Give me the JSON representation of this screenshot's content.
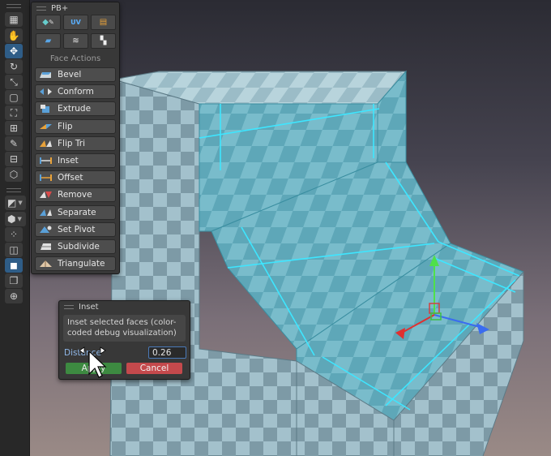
{
  "panel": {
    "title": "PB+",
    "section_label": "Face Actions",
    "mode_buttons": [
      {
        "icon": "new-shape-icon"
      },
      {
        "icon": "uv-editor-icon",
        "text": "UV"
      },
      {
        "icon": "material-editor-icon"
      },
      {
        "icon": "smoothing-groups-icon"
      },
      {
        "icon": "vertex-color-icon"
      },
      {
        "icon": "checker-texture-icon"
      }
    ],
    "actions": [
      {
        "label": "Bevel",
        "icon": "bevel-icon"
      },
      {
        "label": "Conform",
        "icon": "conform-icon"
      },
      {
        "label": "Extrude",
        "icon": "extrude-icon"
      },
      {
        "label": "Flip",
        "icon": "flip-icon"
      },
      {
        "label": "Flip Tri",
        "icon": "flip-tri-icon"
      },
      {
        "label": "Inset",
        "icon": "inset-icon"
      },
      {
        "label": "Offset",
        "icon": "offset-icon"
      },
      {
        "label": "Remove",
        "icon": "remove-icon"
      },
      {
        "label": "Separate",
        "icon": "separate-icon"
      },
      {
        "label": "Set Pivot",
        "icon": "set-pivot-icon"
      },
      {
        "label": "Subdivide",
        "icon": "subdivide-icon"
      },
      {
        "label": "Triangulate",
        "icon": "triangulate-icon"
      }
    ]
  },
  "inset_popup": {
    "title": "Inset",
    "description": "Inset selected faces (color-coded debug visualization)",
    "distance_label": "Distance",
    "distance_value": "0.26",
    "apply_label": "Apply",
    "cancel_label": "Cancel"
  },
  "toolbar": {
    "tools": [
      {
        "icon": "grid-view-icon",
        "active": false
      },
      {
        "icon": "hand-pan-icon",
        "active": false
      },
      {
        "icon": "move-tool-icon",
        "active": true
      },
      {
        "icon": "rotate-tool-icon",
        "active": false
      },
      {
        "icon": "scale-tool-icon",
        "active": false
      },
      {
        "icon": "rect-tool-icon",
        "active": false
      },
      {
        "icon": "transform-tool-icon",
        "active": false
      },
      {
        "icon": "grid-snap-icon",
        "active": false
      },
      {
        "icon": "paint-tool-icon",
        "active": false
      },
      {
        "icon": "probuilder-edit-icon",
        "active": false
      },
      {
        "icon": "cube-select-icon",
        "active": false
      }
    ],
    "mode_tools": [
      {
        "icon": "shape-tool-icon"
      },
      {
        "icon": "poly-shape-icon"
      },
      {
        "icon": "vertex-mode-icon"
      },
      {
        "icon": "edge-mode-icon"
      },
      {
        "icon": "face-mode-icon",
        "active": true
      },
      {
        "icon": "object-mode-icon"
      },
      {
        "icon": "pivot-mode-icon"
      }
    ]
  },
  "colors": {
    "accent_blue": "#2f5d87",
    "apply_green": "#3d8a41",
    "cancel_red": "#c4494c",
    "mesh_face": "#a9c8d2",
    "mesh_selected": "#6ab8c6",
    "edge_highlight": "#3ee6ff"
  }
}
